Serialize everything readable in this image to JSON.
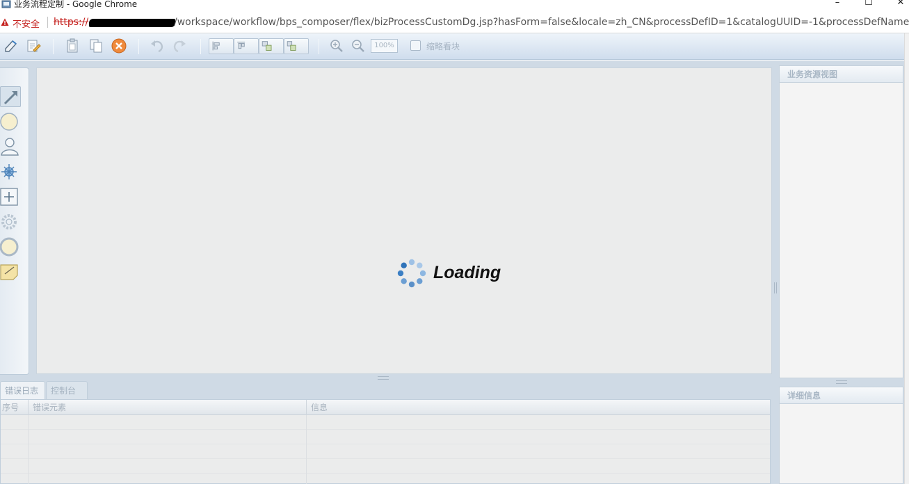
{
  "window": {
    "title": "业务流程定制 - Google Chrome",
    "controls": {
      "minimize": "–",
      "maximize": "☐",
      "close": "✕"
    }
  },
  "addressbar": {
    "security_label": "不安全",
    "url_scheme": "https://",
    "url_path": "/workspace/workflow/bps_composer/flex/bizProcessCustomDg.jsp?hasForm=false&locale=zh_CN&processDefID=1&catalogUUID=-1&processDefName=g..."
  },
  "toolbar": {
    "zoom_value": "100%",
    "thumbnail_label": "缩略看块",
    "icons": [
      "save-icon",
      "edit-properties-icon",
      "paste-icon",
      "copy-icon",
      "delete-icon",
      "undo-icon",
      "redo-icon",
      "align-left-icon",
      "align-top-icon",
      "align-center-icon",
      "align-bottom-icon",
      "zoom-in-icon",
      "zoom-out-icon"
    ]
  },
  "palette": {
    "items": [
      "connector-tool-icon",
      "start-event-icon",
      "manual-activity-icon",
      "auto-activity-icon",
      "subprocess-icon",
      "route-activity-icon",
      "end-event-icon",
      "note-icon"
    ]
  },
  "canvas": {
    "loading_text": "Loading"
  },
  "bottom_panel": {
    "tabs": [
      {
        "label": "错误日志",
        "active": true
      },
      {
        "label": "控制台",
        "active": false
      }
    ],
    "columns": [
      "序号",
      "错误元素",
      "信息"
    ]
  },
  "right_panels": {
    "resource_view_title": "业务资源视图",
    "detail_title": "详细信息"
  },
  "colors": {
    "accent": "#3b7fc4",
    "insecure_red": "#c5221f",
    "toolbar_top": "#eef4fa",
    "toolbar_bottom": "#cfdded",
    "canvas_bg": "#ebecec"
  }
}
